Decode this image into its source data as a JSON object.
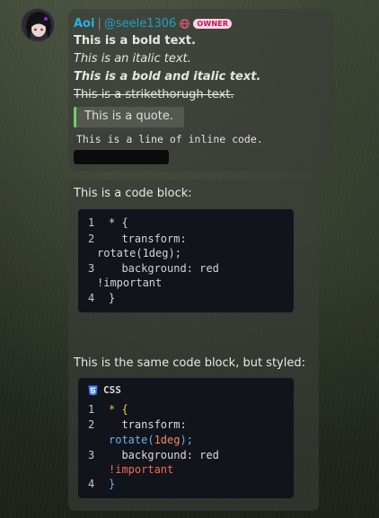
{
  "message": {
    "username": "Aoi",
    "separator": "|",
    "handle": "@seele1306",
    "badge": "OWNER",
    "bold_text": "This is a bold text.",
    "italic_text": "This is an italic text.",
    "bold_italic_text": "This is a bold and italic text.",
    "strike_text": "This is a strikethorugh text.",
    "quote_text": "This is a quote.",
    "inline_code": "This is a line of inline code.",
    "spoiler_hidden": true
  },
  "code_message": {
    "label_plain": "This is a code block:",
    "label_styled": "This is the same code block, but styled:",
    "language": "CSS",
    "line_numbers": [
      "1",
      "2",
      "3",
      "4"
    ],
    "plain_lines": [
      "* {",
      "  transform:",
      "rotate(1deg);",
      "  background: red",
      "!important",
      "}"
    ],
    "styled": {
      "l1_selector": "*",
      "l1_brace": "{",
      "l2_prop": "  transform:",
      "l3_fn": "rotate(",
      "l3_num": "1deg",
      "l3_close": ");",
      "l4_prop": "  background: red",
      "l5_bang": "!important",
      "l6_brace": "}"
    }
  },
  "colors": {
    "username": "#22b4e0",
    "quote_bar": "#6ccf6c",
    "badge_bg": "#ffd4e0",
    "code_bg": "#12141b"
  },
  "icons": [
    "avatar",
    "globe-icon",
    "css3-icon"
  ]
}
